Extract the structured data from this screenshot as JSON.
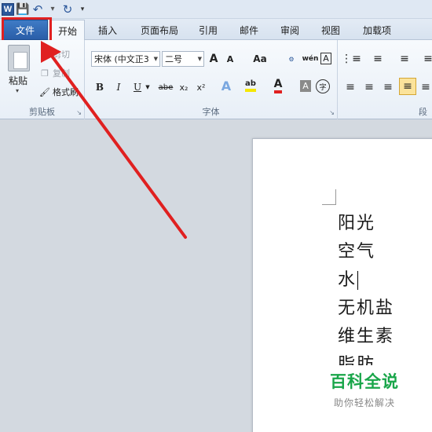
{
  "app": {
    "logo": "W"
  },
  "quick_access": {
    "icons": [
      "word-logo-icon",
      "save-icon",
      "undo-icon",
      "undo-dropdown-icon",
      "redo-icon",
      "customize-toolbar-icon"
    ]
  },
  "tabs": [
    {
      "label": "文件",
      "active": false,
      "highlighted": true
    },
    {
      "label": "开始",
      "active": true
    },
    {
      "label": "插入"
    },
    {
      "label": "页面布局"
    },
    {
      "label": "引用"
    },
    {
      "label": "邮件"
    },
    {
      "label": "审阅"
    },
    {
      "label": "视图"
    },
    {
      "label": "加载项"
    }
  ],
  "ribbon": {
    "clipboard": {
      "paste_label": "粘贴",
      "cut_label": "剪切",
      "copy_label": "复制",
      "format_painter_label": "格式刷",
      "group_label": "剪贴板"
    },
    "font": {
      "font_name": "宋体 (中文正3",
      "font_size": "二号",
      "grow_label": "A",
      "shrink_label": "A",
      "case_label": "Aa",
      "phonetic_label": "wén",
      "border_char": "A",
      "bold_label": "B",
      "italic_label": "I",
      "underline_label": "U",
      "strike_label": "abe",
      "subscript_label": "x₂",
      "superscript_label": "x²",
      "effects_label": "A",
      "highlight_label": "ab",
      "font_color_label": "A",
      "shading_label": "A",
      "enclose_label": "字",
      "group_label": "字体",
      "highlight_color": "#f5e700",
      "font_color": "#e02020"
    },
    "paragraph": {
      "group_label": "段"
    }
  },
  "document": {
    "lines": [
      "阳光",
      "空气",
      "水",
      "无机盐",
      "维生素",
      "脂肪"
    ],
    "cursor_line_index": 2
  },
  "watermark": {
    "title": "百科全说",
    "subtitle": "助你轻松解决"
  },
  "annotation": {
    "highlight_color": "#e02020"
  }
}
